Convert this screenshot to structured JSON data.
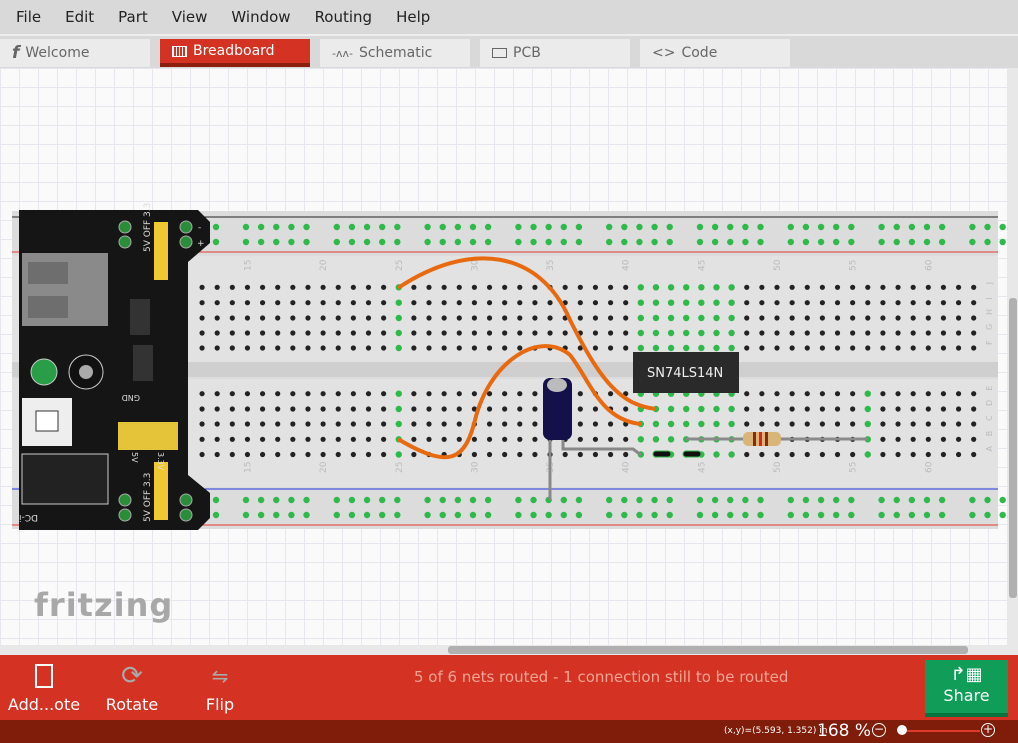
{
  "menu": [
    "File",
    "Edit",
    "Part",
    "View",
    "Window",
    "Routing",
    "Help"
  ],
  "tabs": [
    {
      "label": "Welcome",
      "icon": "fritzing-f-icon"
    },
    {
      "label": "Breadboard",
      "icon": "breadboard-icon",
      "active": true
    },
    {
      "label": "Schematic",
      "icon": "resistor-symbol-icon"
    },
    {
      "label": "PCB",
      "icon": "pcb-icon"
    },
    {
      "label": "Code",
      "icon": "code-brackets-icon"
    }
  ],
  "canvas": {
    "logo": "fritzing",
    "breadboard": {
      "column_labels": [
        "15",
        "20",
        "25",
        "30",
        "35",
        "40",
        "45",
        "50",
        "55",
        "60"
      ],
      "row_labels_top": [
        "J",
        "I",
        "H",
        "G",
        "F"
      ],
      "row_labels_bottom": [
        "E",
        "D",
        "C",
        "B",
        "A"
      ]
    },
    "power_module": {
      "labels": {
        "top_jumper": "5V OFF 3.3",
        "bottom_jumper": "5V OFF 3.3",
        "gnd": "GND",
        "v5": "5V",
        "v33": "3.3V",
        "dc": "DC-in",
        "rail_minus": "-",
        "rail_plus": "+"
      }
    },
    "chip": {
      "label": "SN74LS14N"
    },
    "colors": {
      "wire": "#e86a10",
      "connected_hole": "#2fb94a",
      "rail_red": "#e53935",
      "rail_blue": "#2233dd"
    }
  },
  "toolbar": {
    "add_note": "Add...ote",
    "rotate": "Rotate",
    "flip": "Flip",
    "share": "Share",
    "status": "5 of 6 nets routed - 1 connection still to be routed"
  },
  "statusbar": {
    "coords": "(x,y)=(5.593, 1.352) in",
    "zoom": "168 %",
    "zoom_out": "−",
    "zoom_in": "+"
  },
  "zoom_level_percent": 168
}
